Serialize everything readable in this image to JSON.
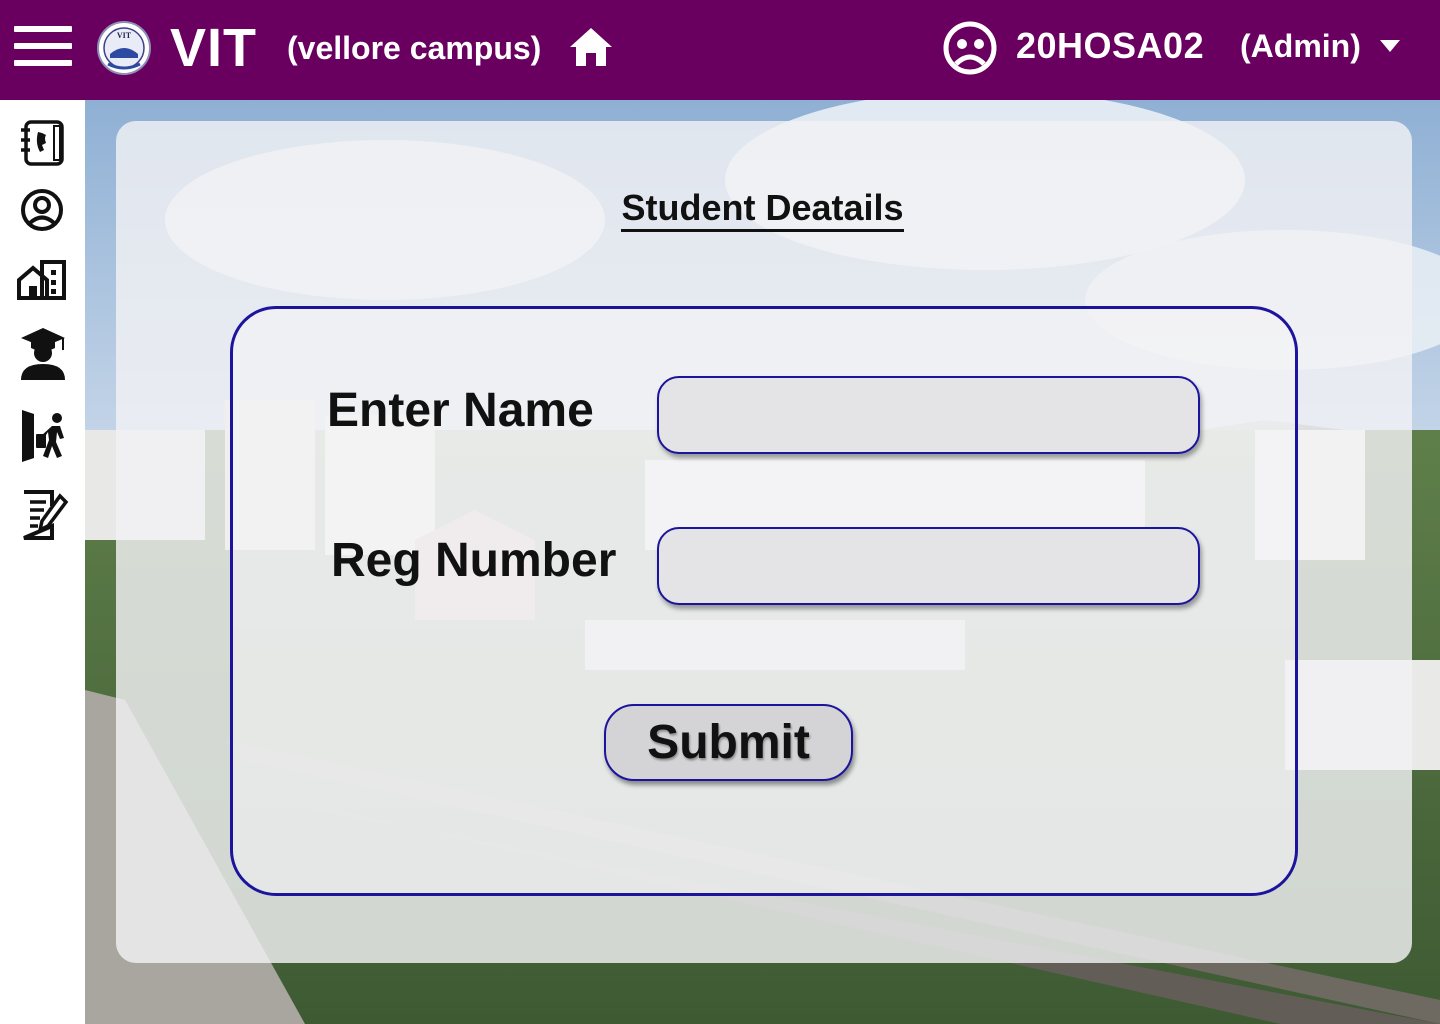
{
  "header": {
    "brand": "VIT",
    "campus": "(vellore campus)",
    "user_id": "20HOSA02",
    "user_role": "(Admin)",
    "logo_text": "VIT"
  },
  "sidebar": {
    "items": [
      {
        "icon": "contacts-book-icon"
      },
      {
        "icon": "user-profile-icon"
      },
      {
        "icon": "buildings-icon"
      },
      {
        "icon": "graduate-icon"
      },
      {
        "icon": "exit-leave-icon"
      },
      {
        "icon": "edit-document-icon"
      }
    ]
  },
  "form": {
    "title": "Student Deatails",
    "name_label": "Enter Name",
    "name_value": "",
    "reg_label": "Reg Number",
    "reg_value": "",
    "submit_label": "Submit"
  },
  "colors": {
    "header_bg": "#69005f",
    "form_border": "#1c149c",
    "input_bg": "#e4e4e6",
    "button_bg": "#d4d4d6"
  }
}
